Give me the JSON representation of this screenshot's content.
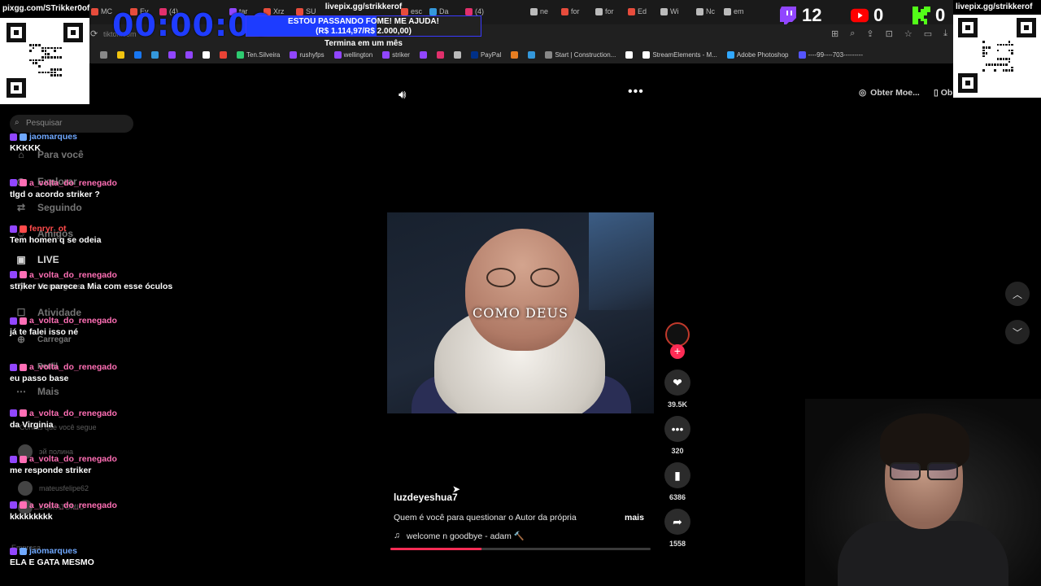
{
  "browser": {
    "url": "tiktok.com",
    "tabs": [
      {
        "label": "MC",
        "color": "#e74c3c"
      },
      {
        "label": "Ev",
        "color": "#e74c3c"
      },
      {
        "label": "(4)",
        "color": "#e1306c"
      },
      {
        "label": "tar",
        "color": "#9146ff"
      },
      {
        "label": "Xrz",
        "color": "#e74c3c"
      },
      {
        "label": "SU",
        "color": "#e74c3c"
      },
      {
        "label": "esc",
        "color": "#e74c3c"
      },
      {
        "label": "Da",
        "color": "#3498db"
      },
      {
        "label": "(4)",
        "color": "#e1306c"
      },
      {
        "label": "ne",
        "color": "#bbbbbb"
      },
      {
        "label": "for",
        "color": "#e74c3c"
      },
      {
        "label": "for",
        "color": "#bbbbbb"
      },
      {
        "label": "Ed",
        "color": "#e74c3c"
      },
      {
        "label": "Wi",
        "color": "#bbbbbb"
      },
      {
        "label": "Nc",
        "color": "#bbbbbb"
      },
      {
        "label": "em",
        "color": "#bbbbbb"
      }
    ],
    "bookmarks": [
      {
        "label": "",
        "color": "#888888"
      },
      {
        "label": "",
        "color": "#f1c40f"
      },
      {
        "label": "",
        "color": "#1877f2"
      },
      {
        "label": "",
        "color": "#3498db"
      },
      {
        "label": "",
        "color": "#9146ff"
      },
      {
        "label": "",
        "color": "#9146ff"
      },
      {
        "label": "",
        "color": "#ffffff"
      },
      {
        "label": "",
        "color": "#ea4335"
      },
      {
        "label": "Ten.Silveira",
        "color": "#2ecc71"
      },
      {
        "label": "rushyfps",
        "color": "#9146ff"
      },
      {
        "label": "wellington",
        "color": "#9146ff"
      },
      {
        "label": "striker",
        "color": "#9146ff"
      },
      {
        "label": "",
        "color": "#9146ff"
      },
      {
        "label": "",
        "color": "#e1306c"
      },
      {
        "label": "",
        "color": "#bbbbbb"
      },
      {
        "label": "PayPal",
        "color": "#003087"
      },
      {
        "label": "",
        "color": "#e67e22"
      },
      {
        "label": "",
        "color": "#3498db"
      },
      {
        "label": "Start | Construction...",
        "color": "#888888"
      },
      {
        "label": "",
        "color": "#ffffff"
      },
      {
        "label": "StreamElements - M...",
        "color": "#ffffff"
      },
      {
        "label": "Adobe Photoshop",
        "color": "#31a8ff"
      },
      {
        "label": "----99----703---------",
        "color": "#5555ff"
      }
    ]
  },
  "overlay": {
    "qr_left_label": "pixgg.com/STrikker0of",
    "qr_right_label": "livepix.gg/strikkerof",
    "timer": "00:00:00",
    "donation": {
      "link": "livepix.gg/strikkerof",
      "message": "ESTOU PASSANDO FOME! ME AJUDA!",
      "amount": "(R$ 1.114,97/R$ 2.000,00)",
      "progress": 0.557,
      "ends": "Termina em um mês"
    },
    "twitch_viewers": "12",
    "youtube_viewers": "0",
    "kick_viewers": "0"
  },
  "sidebar": {
    "search_placeholder": "Pesquisar",
    "items": [
      {
        "label": "Para você",
        "icon": "home-icon"
      },
      {
        "label": "Explorar",
        "icon": "compass-icon"
      },
      {
        "label": "Seguindo",
        "icon": "following-icon"
      },
      {
        "label": "Amigos",
        "icon": "friends-icon"
      },
      {
        "label": "LIVE",
        "icon": "live-icon"
      },
      {
        "label": "Mensagens",
        "icon": "message-icon"
      },
      {
        "label": "Atividade",
        "icon": "inbox-icon"
      },
      {
        "label": "Carregar",
        "icon": "upload-icon"
      },
      {
        "label": "Perfil",
        "icon": "profile-icon"
      },
      {
        "label": "Mais",
        "icon": "more-icon"
      }
    ],
    "following_title": "Contas que você segue",
    "following": [
      {
        "name": "эй полина"
      },
      {
        "name": "mateusfelipe62"
      },
      {
        "name": "LAM.ATOMIC"
      }
    ],
    "footer": "Empresa"
  },
  "chat": [
    {
      "user": "jaomarques",
      "color": "#6fa8ff",
      "text": "KKKKK"
    },
    {
      "user": "a_volta_do_renegado",
      "color": "#ff6fb5",
      "text": "tlgd o acordo striker ?"
    },
    {
      "user": "fenryr_ot",
      "color": "#ff4b4b",
      "text": "Tem homen q se odeia"
    },
    {
      "user": "a_volta_do_renegado",
      "color": "#ff6fb5",
      "text": "striker vc parece a Mia com esse óculos"
    },
    {
      "user": "a_volta_do_renegado",
      "color": "#ff6fb5",
      "text": "já te falei isso né"
    },
    {
      "user": "a_volta_do_renegado",
      "color": "#ff6fb5",
      "text": "eu passo base"
    },
    {
      "user": "a_volta_do_renegado",
      "color": "#ff6fb5",
      "text": "da Virginia"
    },
    {
      "user": "a_volta_do_renegado",
      "color": "#ff6fb5",
      "text": "me responde striker"
    },
    {
      "user": "a_volta_do_renegado",
      "color": "#ff6fb5",
      "text": "kkkkkkkkk"
    },
    {
      "user": "jaomarques",
      "color": "#6fa8ff",
      "text": "ELA E GATA MESMO"
    }
  ],
  "video": {
    "caption": "COMO DEUS",
    "author": "luzdeyeshua7",
    "description": "Quem é você para questionar o Autor da própria",
    "more": "mais",
    "music": "welcome n goodbye - adam 🔨",
    "progress": 0.35,
    "likes": "39.5K",
    "comments": "320",
    "saves": "6386",
    "shares": "1558",
    "coins_label": "Obter Moe...",
    "coins2_label": "Ob"
  }
}
